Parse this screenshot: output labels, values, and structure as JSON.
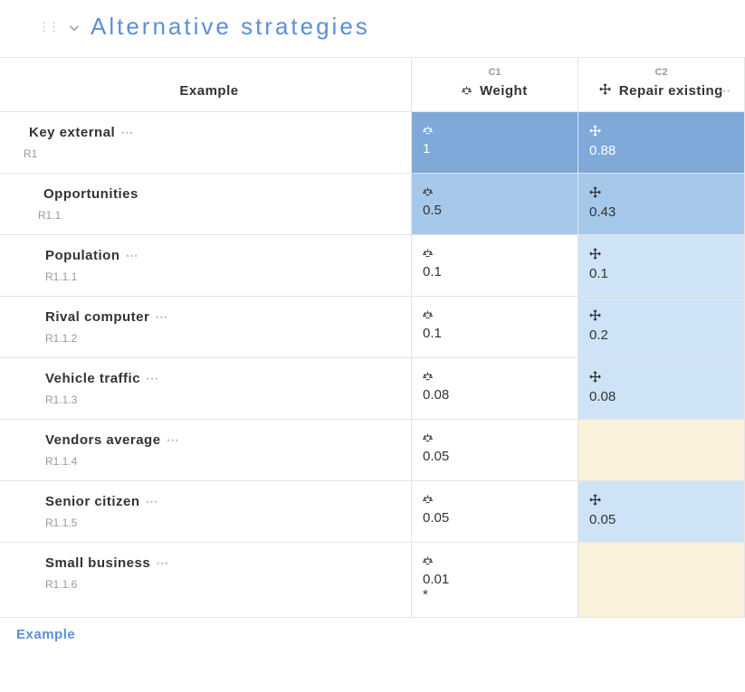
{
  "header": {
    "title": "Alternative strategies"
  },
  "table": {
    "label_header": "Example",
    "columns": [
      {
        "id": "C1",
        "name": "Weight",
        "icon": "scale",
        "actions": false
      },
      {
        "id": "C2",
        "name": "Repair existing",
        "icon": "move",
        "actions": true
      }
    ],
    "rows": [
      {
        "id": "R1",
        "name": "Key external",
        "bullet": "target",
        "indent": 0,
        "expandable": true,
        "dots": true,
        "cells": [
          {
            "icon": "scale",
            "val": "1",
            "bg": "bg-dark"
          },
          {
            "icon": "move",
            "val": "0.88",
            "bg": "bg-dark"
          }
        ]
      },
      {
        "id": "R1.1",
        "name": "Opportunities",
        "bullet": "circle",
        "indent": 1,
        "expandable": true,
        "dots": false,
        "cells": [
          {
            "icon": "scale",
            "val": "0.5",
            "bg": "bg-med"
          },
          {
            "icon": "move",
            "val": "0.43",
            "bg": "bg-med"
          }
        ]
      },
      {
        "id": "R1.1.1",
        "name": "Population",
        "bullet": "",
        "indent": 2,
        "expandable": false,
        "dots": true,
        "cells": [
          {
            "icon": "scale",
            "val": "0.1",
            "bg": ""
          },
          {
            "icon": "move",
            "val": "0.1",
            "bg": "bg-light"
          }
        ]
      },
      {
        "id": "R1.1.2",
        "name": "Rival computer",
        "bullet": "",
        "indent": 2,
        "expandable": false,
        "dots": true,
        "cells": [
          {
            "icon": "scale",
            "val": "0.1",
            "bg": ""
          },
          {
            "icon": "move",
            "val": "0.2",
            "bg": "bg-light"
          }
        ]
      },
      {
        "id": "R1.1.3",
        "name": "Vehicle traffic",
        "bullet": "",
        "indent": 2,
        "expandable": false,
        "dots": true,
        "cells": [
          {
            "icon": "scale",
            "val": "0.08",
            "bg": ""
          },
          {
            "icon": "move",
            "val": "0.08",
            "bg": "bg-light"
          }
        ]
      },
      {
        "id": "R1.1.4",
        "name": "Vendors average",
        "bullet": "",
        "indent": 2,
        "expandable": false,
        "dots": true,
        "cells": [
          {
            "icon": "scale",
            "val": "0.05",
            "bg": ""
          },
          {
            "icon": "",
            "val": "",
            "bg": "bg-cream"
          }
        ]
      },
      {
        "id": "R1.1.5",
        "name": "Senior citizen",
        "bullet": "",
        "indent": 2,
        "expandable": false,
        "dots": true,
        "cells": [
          {
            "icon": "scale",
            "val": "0.05",
            "bg": ""
          },
          {
            "icon": "move",
            "val": "0.05",
            "bg": "bg-light"
          }
        ]
      },
      {
        "id": "R1.1.6",
        "name": "Small business",
        "bullet": "",
        "indent": 2,
        "expandable": false,
        "dots": true,
        "cells": [
          {
            "icon": "scale",
            "val": "0.01",
            "note": "*",
            "bg": ""
          },
          {
            "icon": "",
            "val": "",
            "bg": "bg-cream"
          }
        ]
      }
    ],
    "footer_label": "Example"
  }
}
